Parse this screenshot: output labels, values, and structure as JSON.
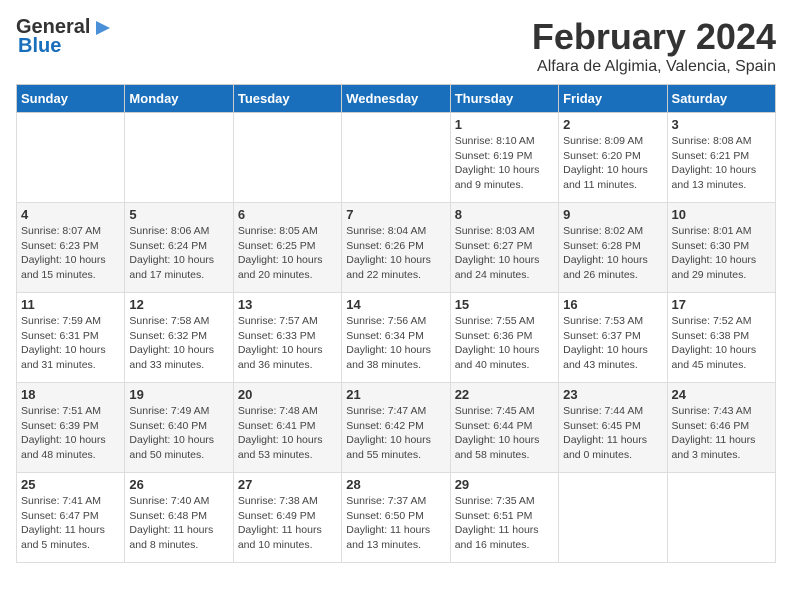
{
  "logo": {
    "line1": "General",
    "line2": "Blue"
  },
  "title": "February 2024",
  "subtitle": "Alfara de Algimia, Valencia, Spain",
  "weekdays": [
    "Sunday",
    "Monday",
    "Tuesday",
    "Wednesday",
    "Thursday",
    "Friday",
    "Saturday"
  ],
  "weeks": [
    [
      {
        "day": "",
        "info": ""
      },
      {
        "day": "",
        "info": ""
      },
      {
        "day": "",
        "info": ""
      },
      {
        "day": "",
        "info": ""
      },
      {
        "day": "1",
        "info": "Sunrise: 8:10 AM\nSunset: 6:19 PM\nDaylight: 10 hours\nand 9 minutes."
      },
      {
        "day": "2",
        "info": "Sunrise: 8:09 AM\nSunset: 6:20 PM\nDaylight: 10 hours\nand 11 minutes."
      },
      {
        "day": "3",
        "info": "Sunrise: 8:08 AM\nSunset: 6:21 PM\nDaylight: 10 hours\nand 13 minutes."
      }
    ],
    [
      {
        "day": "4",
        "info": "Sunrise: 8:07 AM\nSunset: 6:23 PM\nDaylight: 10 hours\nand 15 minutes."
      },
      {
        "day": "5",
        "info": "Sunrise: 8:06 AM\nSunset: 6:24 PM\nDaylight: 10 hours\nand 17 minutes."
      },
      {
        "day": "6",
        "info": "Sunrise: 8:05 AM\nSunset: 6:25 PM\nDaylight: 10 hours\nand 20 minutes."
      },
      {
        "day": "7",
        "info": "Sunrise: 8:04 AM\nSunset: 6:26 PM\nDaylight: 10 hours\nand 22 minutes."
      },
      {
        "day": "8",
        "info": "Sunrise: 8:03 AM\nSunset: 6:27 PM\nDaylight: 10 hours\nand 24 minutes."
      },
      {
        "day": "9",
        "info": "Sunrise: 8:02 AM\nSunset: 6:28 PM\nDaylight: 10 hours\nand 26 minutes."
      },
      {
        "day": "10",
        "info": "Sunrise: 8:01 AM\nSunset: 6:30 PM\nDaylight: 10 hours\nand 29 minutes."
      }
    ],
    [
      {
        "day": "11",
        "info": "Sunrise: 7:59 AM\nSunset: 6:31 PM\nDaylight: 10 hours\nand 31 minutes."
      },
      {
        "day": "12",
        "info": "Sunrise: 7:58 AM\nSunset: 6:32 PM\nDaylight: 10 hours\nand 33 minutes."
      },
      {
        "day": "13",
        "info": "Sunrise: 7:57 AM\nSunset: 6:33 PM\nDaylight: 10 hours\nand 36 minutes."
      },
      {
        "day": "14",
        "info": "Sunrise: 7:56 AM\nSunset: 6:34 PM\nDaylight: 10 hours\nand 38 minutes."
      },
      {
        "day": "15",
        "info": "Sunrise: 7:55 AM\nSunset: 6:36 PM\nDaylight: 10 hours\nand 40 minutes."
      },
      {
        "day": "16",
        "info": "Sunrise: 7:53 AM\nSunset: 6:37 PM\nDaylight: 10 hours\nand 43 minutes."
      },
      {
        "day": "17",
        "info": "Sunrise: 7:52 AM\nSunset: 6:38 PM\nDaylight: 10 hours\nand 45 minutes."
      }
    ],
    [
      {
        "day": "18",
        "info": "Sunrise: 7:51 AM\nSunset: 6:39 PM\nDaylight: 10 hours\nand 48 minutes."
      },
      {
        "day": "19",
        "info": "Sunrise: 7:49 AM\nSunset: 6:40 PM\nDaylight: 10 hours\nand 50 minutes."
      },
      {
        "day": "20",
        "info": "Sunrise: 7:48 AM\nSunset: 6:41 PM\nDaylight: 10 hours\nand 53 minutes."
      },
      {
        "day": "21",
        "info": "Sunrise: 7:47 AM\nSunset: 6:42 PM\nDaylight: 10 hours\nand 55 minutes."
      },
      {
        "day": "22",
        "info": "Sunrise: 7:45 AM\nSunset: 6:44 PM\nDaylight: 10 hours\nand 58 minutes."
      },
      {
        "day": "23",
        "info": "Sunrise: 7:44 AM\nSunset: 6:45 PM\nDaylight: 11 hours\nand 0 minutes."
      },
      {
        "day": "24",
        "info": "Sunrise: 7:43 AM\nSunset: 6:46 PM\nDaylight: 11 hours\nand 3 minutes."
      }
    ],
    [
      {
        "day": "25",
        "info": "Sunrise: 7:41 AM\nSunset: 6:47 PM\nDaylight: 11 hours\nand 5 minutes."
      },
      {
        "day": "26",
        "info": "Sunrise: 7:40 AM\nSunset: 6:48 PM\nDaylight: 11 hours\nand 8 minutes."
      },
      {
        "day": "27",
        "info": "Sunrise: 7:38 AM\nSunset: 6:49 PM\nDaylight: 11 hours\nand 10 minutes."
      },
      {
        "day": "28",
        "info": "Sunrise: 7:37 AM\nSunset: 6:50 PM\nDaylight: 11 hours\nand 13 minutes."
      },
      {
        "day": "29",
        "info": "Sunrise: 7:35 AM\nSunset: 6:51 PM\nDaylight: 11 hours\nand 16 minutes."
      },
      {
        "day": "",
        "info": ""
      },
      {
        "day": "",
        "info": ""
      }
    ]
  ]
}
